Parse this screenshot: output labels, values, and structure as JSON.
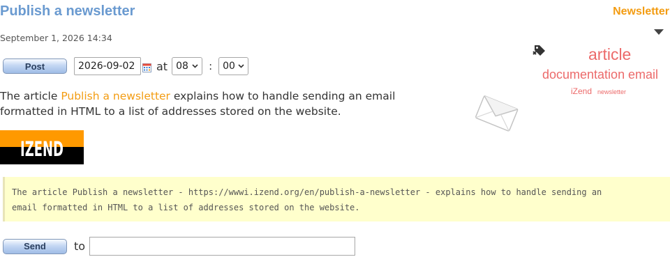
{
  "page": {
    "title": "Publish a newsletter",
    "date": "September 1, 2026 14:34"
  },
  "post_form": {
    "post_label": "Post",
    "date_value": "2026-09-02",
    "at_label": "at",
    "hour_value": "08",
    "colon_label": ":",
    "minute_value": "00"
  },
  "article": {
    "text_before": "The article ",
    "link_text": "Publish a newsletter",
    "text_after": " explains how to handle sending an email formatted in HTML to a list of addresses stored on the website."
  },
  "logo": {
    "text": "IZEND",
    "colors": {
      "top": "#ff9900",
      "bottom": "#000000",
      "text": "#ffffff"
    }
  },
  "preview": {
    "line1": "The article Publish a newsletter - https://wwwi.izend.org/en/publish-a-newsletter - explains how to handle sending an",
    "line2": "email formatted in HTML to a list of addresses stored on the website."
  },
  "send_form": {
    "send_label": "Send",
    "to_label": "to",
    "recipient_value": ""
  },
  "sidebar": {
    "title": "Newsletter",
    "icons": [
      "chevron-down-icon",
      "tag-icon",
      "envelope-icon"
    ],
    "tags": [
      "article",
      "documentation",
      "email",
      "iZend",
      "newsletter"
    ]
  },
  "colors": {
    "title": "#6a9ad0",
    "accent": "#f39c12",
    "tag": "#ec6a6a",
    "preview_background": "#ffffcc"
  }
}
